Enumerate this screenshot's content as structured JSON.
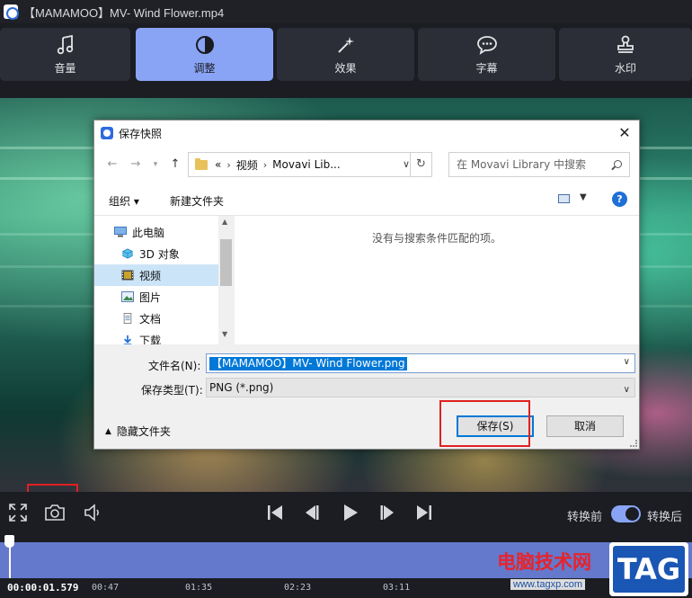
{
  "window": {
    "title": "【MAMAMOO】MV- Wind Flower.mp4"
  },
  "tabs": [
    {
      "label": "音量",
      "icon": "music-note-icon"
    },
    {
      "label": "调整",
      "icon": "contrast-icon",
      "active": true
    },
    {
      "label": "效果",
      "icon": "magic-wand-icon"
    },
    {
      "label": "字幕",
      "icon": "speech-bubble-icon"
    },
    {
      "label": "水印",
      "icon": "stamp-icon"
    }
  ],
  "dialog": {
    "title": "保存快照",
    "breadcrumb": {
      "overflow": "«",
      "items": [
        "视频",
        "Movavi Lib..."
      ]
    },
    "search_placeholder": "在 Movavi Library 中搜索",
    "organize_label": "组织 ▾",
    "new_folder_label": "新建文件夹",
    "nav_items": [
      {
        "label": "此电脑",
        "icon": "computer-icon"
      },
      {
        "label": "3D 对象",
        "icon": "cube-icon"
      },
      {
        "label": "视频",
        "icon": "video-folder-icon",
        "selected": true
      },
      {
        "label": "图片",
        "icon": "pictures-folder-icon"
      },
      {
        "label": "文档",
        "icon": "documents-folder-icon"
      },
      {
        "label": "下载",
        "icon": "download-folder-icon"
      }
    ],
    "empty_message": "没有与搜索条件匹配的项。",
    "filename_label": "文件名(N):",
    "filename_value": "【MAMAMOO】MV- Wind Flower.png",
    "filetype_label": "保存类型(T):",
    "filetype_value": "PNG (*.png)",
    "hide_folders_label": "隐藏文件夹",
    "save_label": "保存(S)",
    "cancel_label": "取消"
  },
  "player": {
    "toggle_before": "转换前",
    "toggle_after": "转换后",
    "toggle_on": true
  },
  "timeline": {
    "current_time": "00:00:01.579",
    "ticks": [
      "00:47",
      "01:35",
      "02:23",
      "03:11"
    ],
    "playhead_fraction": 0.0
  },
  "watermark": {
    "site_name": "电脑技术网",
    "url": "www.tagxp.com",
    "badge": "TAG"
  },
  "colors": {
    "accent": "#8aa4f5",
    "highlight": "#e02020"
  }
}
